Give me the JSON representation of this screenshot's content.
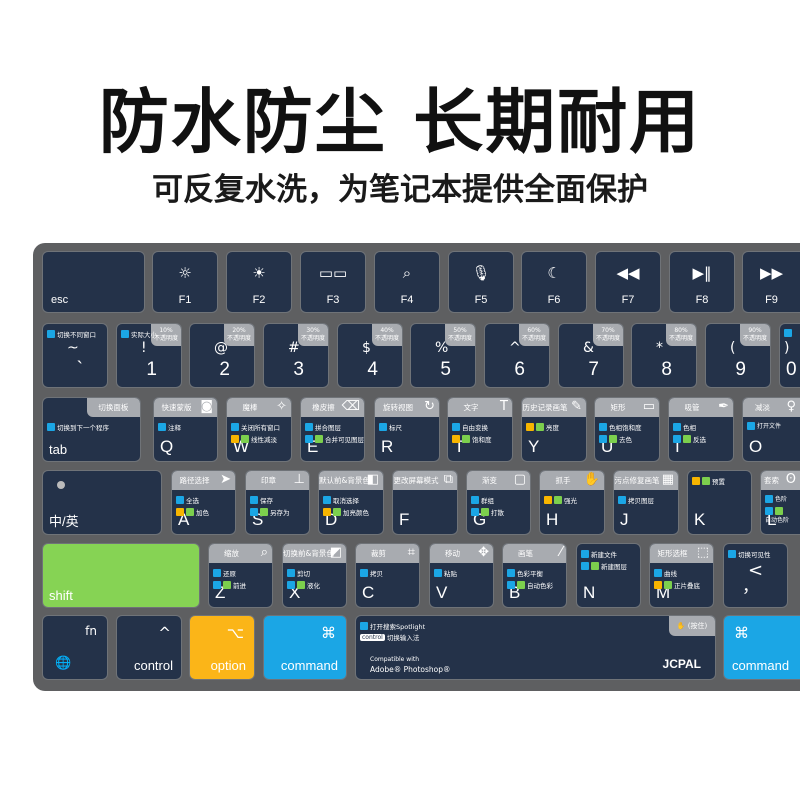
{
  "headline": "防水防尘 长期耐用",
  "subheadline": "可反复水洗，为笔记本提供全面保护",
  "colors": {
    "blue": "#1ba6e5",
    "orange": "#f7b500",
    "green": "#7ccf4d",
    "key": "#243249",
    "header": "#a8abb0",
    "body": "#5e5f61"
  },
  "function_row": [
    {
      "label": "esc"
    },
    {
      "label": "F1",
      "icon": "brightness-low-icon",
      "glyph": "☼"
    },
    {
      "label": "F2",
      "icon": "brightness-high-icon",
      "glyph": "☀"
    },
    {
      "label": "F3",
      "icon": "mission-control-icon",
      "glyph": "▭▭"
    },
    {
      "label": "F4",
      "icon": "search-icon",
      "glyph": "⌕"
    },
    {
      "label": "F5",
      "icon": "microphone-icon",
      "glyph": "🎙"
    },
    {
      "label": "F6",
      "icon": "moon-icon",
      "glyph": "☾"
    },
    {
      "label": "F7",
      "icon": "rewind-icon",
      "glyph": "◀◀"
    },
    {
      "label": "F8",
      "icon": "play-pause-icon",
      "glyph": "▶‖"
    },
    {
      "label": "F9",
      "icon": "fast-forward-icon",
      "glyph": "▶▶"
    }
  ],
  "number_row": [
    {
      "shift": "~",
      "main": "`",
      "shortcuts": [
        {
          "colors": [
            "blue"
          ],
          "text": "切换不同窗口"
        }
      ]
    },
    {
      "shift": "!",
      "main": "1",
      "corner": [
        "10%",
        "不透明度"
      ],
      "shortcuts": [
        {
          "colors": [
            "blue"
          ],
          "text": "实际大小"
        }
      ]
    },
    {
      "shift": "@",
      "main": "2",
      "corner": [
        "20%",
        "不透明度"
      ]
    },
    {
      "shift": "#",
      "main": "3",
      "corner": [
        "30%",
        "不透明度"
      ]
    },
    {
      "shift": "$",
      "main": "4",
      "corner": [
        "40%",
        "不透明度"
      ]
    },
    {
      "shift": "%",
      "main": "5",
      "corner": [
        "50%",
        "不透明度"
      ]
    },
    {
      "shift": "^",
      "main": "6",
      "corner": [
        "60%",
        "不透明度"
      ]
    },
    {
      "shift": "&",
      "main": "7",
      "corner": [
        "70%",
        "不透明度"
      ]
    },
    {
      "shift": "*",
      "main": "8",
      "corner": [
        "80%",
        "不透明度"
      ]
    },
    {
      "shift": "(",
      "main": "9",
      "corner": [
        "90%",
        "不透明度"
      ]
    },
    {
      "shift": ")",
      "main": "0",
      "shortcuts": [
        {
          "colors": [
            "blue"
          ],
          "text": ""
        }
      ]
    }
  ],
  "tab_row": [
    {
      "main": "tab",
      "header": "切换面板",
      "shortcuts": [
        {
          "colors": [
            "blue"
          ],
          "text": "切换到下一个程序"
        }
      ]
    },
    {
      "main": "Q",
      "header": "快速蒙版",
      "icon": "quick-mask-icon",
      "glyph": "◙",
      "shortcuts": [
        {
          "colors": [
            "blue"
          ],
          "text": "注释"
        }
      ]
    },
    {
      "main": "W",
      "header": "魔棒",
      "icon": "magic-wand-icon",
      "glyph": "✧",
      "shortcuts": [
        {
          "colors": [
            "blue"
          ],
          "text": "关闭所有窗口"
        },
        {
          "colors": [
            "orange",
            "green"
          ],
          "text": "线性减淡"
        }
      ]
    },
    {
      "main": "E",
      "header": "橡皮擦",
      "icon": "eraser-icon",
      "glyph": "⌫",
      "shortcuts": [
        {
          "colors": [
            "blue"
          ],
          "text": "拼合图层"
        },
        {
          "colors": [
            "blue",
            "green"
          ],
          "text": "合并可见图层"
        }
      ]
    },
    {
      "main": "R",
      "header": "旋转视图",
      "icon": "rotate-view-icon",
      "glyph": "↻",
      "shortcuts": [
        {
          "colors": [
            "blue"
          ],
          "text": "标尺"
        }
      ]
    },
    {
      "main": "T",
      "header": "文字",
      "icon": "text-tool-icon",
      "glyph": "T",
      "shortcuts": [
        {
          "colors": [
            "blue"
          ],
          "text": "自由变换"
        },
        {
          "colors": [
            "orange",
            "green"
          ],
          "text": "饱和度"
        }
      ]
    },
    {
      "main": "Y",
      "header": "历史记录画笔",
      "icon": "history-brush-icon",
      "glyph": "✎",
      "shortcuts": [
        {
          "colors": [
            "orange",
            "green"
          ],
          "text": "亮度"
        }
      ]
    },
    {
      "main": "U",
      "header": "矩形",
      "icon": "rectangle-icon",
      "glyph": "▭",
      "shortcuts": [
        {
          "colors": [
            "blue"
          ],
          "text": "色相饱和度"
        },
        {
          "colors": [
            "blue",
            "green"
          ],
          "text": "去色"
        }
      ]
    },
    {
      "main": "I",
      "header": "吸管",
      "icon": "eyedropper-icon",
      "glyph": "✒",
      "shortcuts": [
        {
          "colors": [
            "blue"
          ],
          "text": "色相"
        },
        {
          "colors": [
            "blue",
            "green"
          ],
          "text": "反选"
        }
      ]
    },
    {
      "main": "O",
      "header": "减淡",
      "icon": "dodge-icon",
      "glyph": "♀",
      "shortcuts": [
        {
          "colors": [
            "blue"
          ],
          "text": "打开文件"
        }
      ]
    }
  ],
  "caps_row": [
    {
      "main": "中/英",
      "indicator": true
    },
    {
      "main": "A",
      "header": "路径选择",
      "icon": "path-select-icon",
      "glyph": "➤",
      "shortcuts": [
        {
          "colors": [
            "blue"
          ],
          "text": "全选"
        },
        {
          "colors": [
            "orange",
            "green"
          ],
          "text": "加色"
        }
      ]
    },
    {
      "main": "S",
      "header": "印章",
      "icon": "stamp-icon",
      "glyph": "⊥",
      "shortcuts": [
        {
          "colors": [
            "blue"
          ],
          "text": "保存"
        },
        {
          "colors": [
            "blue",
            "green"
          ],
          "text": "另存为"
        }
      ]
    },
    {
      "main": "D",
      "header": "默认前&背景色",
      "icon": "default-colors-icon",
      "glyph": "◧",
      "shortcuts": [
        {
          "colors": [
            "blue"
          ],
          "text": "取消选择"
        },
        {
          "colors": [
            "orange",
            "green"
          ],
          "text": "加亮颜色"
        }
      ]
    },
    {
      "main": "F",
      "header": "更改屏幕模式",
      "icon": "screen-mode-icon",
      "glyph": "⧉"
    },
    {
      "main": "G",
      "header": "渐变",
      "icon": "gradient-icon",
      "glyph": "▢",
      "shortcuts": [
        {
          "colors": [
            "blue"
          ],
          "text": "群组"
        },
        {
          "colors": [
            "blue",
            "green"
          ],
          "text": "打散"
        }
      ]
    },
    {
      "main": "H",
      "header": "抓手",
      "icon": "hand-icon",
      "glyph": "✋",
      "shortcuts": [
        {
          "colors": [
            "orange",
            "green"
          ],
          "text": "强光"
        }
      ]
    },
    {
      "main": "J",
      "header": "污点修复画笔",
      "icon": "healing-brush-icon",
      "glyph": "▦",
      "shortcuts": [
        {
          "colors": [
            "blue"
          ],
          "text": "拷贝图层"
        }
      ]
    },
    {
      "main": "K",
      "shortcuts": [
        {
          "colors": [
            "orange",
            "green"
          ],
          "text": "预置"
        }
      ]
    },
    {
      "main": "L",
      "header": "套索",
      "icon": "lasso-icon",
      "glyph": "ʘ",
      "shortcuts": [
        {
          "colors": [
            "blue"
          ],
          "text": "色阶"
        },
        {
          "colors": [
            "blue",
            "green"
          ],
          "text": "自动色阶"
        }
      ]
    }
  ],
  "shift_row": [
    {
      "main": "shift",
      "variant": "green"
    },
    {
      "main": "Z",
      "header": "缩放",
      "icon": "zoom-icon",
      "glyph": "⌕",
      "shortcuts": [
        {
          "colors": [
            "blue"
          ],
          "text": "还原"
        },
        {
          "colors": [
            "blue",
            "green"
          ],
          "text": "前进"
        }
      ]
    },
    {
      "main": "X",
      "header": "切换前&背景色",
      "icon": "swap-colors-icon",
      "glyph": "◩",
      "shortcuts": [
        {
          "colors": [
            "blue"
          ],
          "text": "剪切"
        },
        {
          "colors": [
            "blue",
            "green"
          ],
          "text": "液化"
        }
      ]
    },
    {
      "main": "C",
      "header": "裁剪",
      "icon": "crop-icon",
      "glyph": "⌗",
      "shortcuts": [
        {
          "colors": [
            "blue"
          ],
          "text": "拷贝"
        }
      ]
    },
    {
      "main": "V",
      "header": "移动",
      "icon": "move-icon",
      "glyph": "✥",
      "shortcuts": [
        {
          "colors": [
            "blue"
          ],
          "text": "粘贴"
        }
      ]
    },
    {
      "main": "B",
      "header": "画笔",
      "icon": "brush-icon",
      "glyph": "⁄",
      "shortcuts": [
        {
          "colors": [
            "blue"
          ],
          "text": "色彩平衡"
        },
        {
          "colors": [
            "blue",
            "green"
          ],
          "text": "自动色彩"
        }
      ]
    },
    {
      "main": "N",
      "shortcuts": [
        {
          "colors": [
            "blue"
          ],
          "text": "新建文件"
        },
        {
          "colors": [
            "blue",
            "green"
          ],
          "text": "新建图层"
        }
      ]
    },
    {
      "main": "M",
      "header": "矩形选框",
      "icon": "marquee-icon",
      "glyph": "⬚",
      "shortcuts": [
        {
          "colors": [
            "blue"
          ],
          "text": "曲线"
        },
        {
          "colors": [
            "orange",
            "green"
          ],
          "text": "正片叠底"
        }
      ]
    },
    {
      "main": "，",
      "shift": "<",
      "shortcuts": [
        {
          "colors": [
            "blue"
          ],
          "text": "切换可见性"
        }
      ]
    }
  ],
  "bottom_row": {
    "fn": {
      "label": "fn",
      "icon": "globe-icon"
    },
    "control": {
      "label": "control",
      "symbol": "^"
    },
    "option": {
      "label": "option",
      "symbol": "⌥"
    },
    "command_left": {
      "label": "command",
      "symbol": "⌘"
    },
    "space": {
      "spotlight": "打开搜索Spotlight",
      "control_pill": "control",
      "switch_input": "切换输入法",
      "compatible": "Compatible with",
      "product": "Adobe® Photoshop®",
      "brand": "JCPAL",
      "hold_label": "(按住)"
    },
    "command_right": {
      "label": "command",
      "symbol": "⌘"
    }
  }
}
